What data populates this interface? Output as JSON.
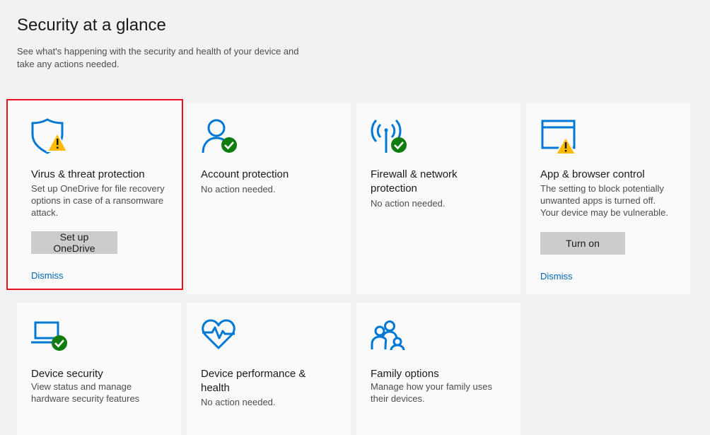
{
  "header": {
    "title": "Security at a glance",
    "subtitle": "See what's happening with the security and health of your device and take any actions needed."
  },
  "colors": {
    "accent": "#0067b8",
    "icon_blue": "#0078d4",
    "ok_green": "#107c10",
    "warn_yellow": "#ffb900",
    "highlight_red": "#e81123"
  },
  "cards": {
    "virus": {
      "icon": "shield-warning-icon",
      "title": "Virus & threat protection",
      "desc": "Set up OneDrive for file recovery options in case of a ransomware attack.",
      "button": "Set up OneDrive",
      "link": "Dismiss"
    },
    "account": {
      "icon": "person-ok-icon",
      "title": "Account protection",
      "desc": "No action needed."
    },
    "firewall": {
      "icon": "antenna-ok-icon",
      "title": "Firewall & network protection",
      "desc": "No action needed."
    },
    "app": {
      "icon": "browser-warning-icon",
      "title": "App & browser control",
      "desc": "The setting to block potentially unwanted apps is turned off. Your device may be vulnerable.",
      "button": "Turn on",
      "link": "Dismiss"
    },
    "device_security": {
      "icon": "laptop-ok-icon",
      "title": "Device security",
      "desc": "View status and manage hardware security features"
    },
    "performance": {
      "icon": "heart-pulse-icon",
      "title": "Device performance & health",
      "desc": "No action needed."
    },
    "family": {
      "icon": "family-icon",
      "title": "Family options",
      "desc": "Manage how your family uses their devices."
    }
  }
}
